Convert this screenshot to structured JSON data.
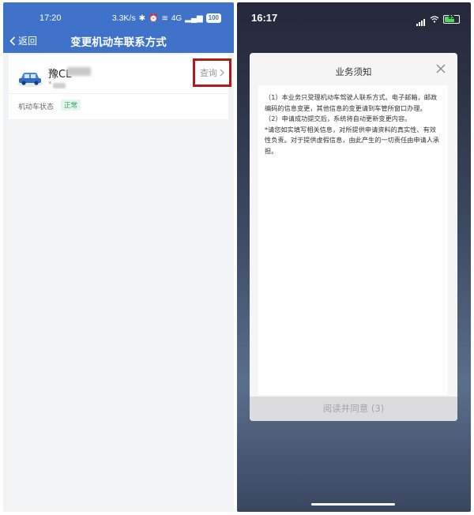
{
  "left": {
    "status": {
      "time": "17:20",
      "speed": "3.3K/s",
      "network": "4G",
      "battery": "100"
    },
    "nav": {
      "back_label": "返回",
      "title": "变更机动车联系方式"
    },
    "vehicle": {
      "plate": "豫CL",
      "sub_prefix": "*",
      "query_label": "查询",
      "status_label": "机动车状态",
      "status_value": "正常"
    },
    "colors": {
      "header": "#3f73c9",
      "highlight_border": "#b11a1a",
      "status_green": "#2fa564"
    }
  },
  "right": {
    "status": {
      "time": "16:17",
      "battery": "83"
    },
    "modal": {
      "title": "业务须知",
      "paragraphs": [
        "（1）本业务只受理机动车驾驶人联系方式、电子邮箱，邮政编码的信息变更，其他信息的变更请到车管所窗口办理。",
        "（2）申请成功提交后，系统将自动更新变更内容。",
        "*请您如实填写相关信息，对所提供申请资料的真实性、有效性负责。对于提供虚假信息，由此产生的一切责任由申请人承担。"
      ],
      "button_label": "阅读并同意 (3)"
    }
  }
}
